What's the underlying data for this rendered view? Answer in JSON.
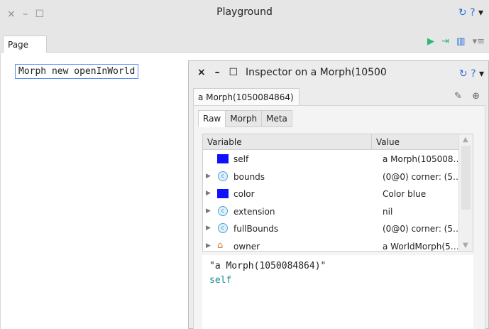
{
  "playground": {
    "title": "Playground",
    "window_controls": "× – ☐",
    "help": "?",
    "menu_arrow": "▾",
    "sync_icon": "↻",
    "tab": "Page",
    "code": "Morph new openInWorld"
  },
  "inspector": {
    "title": "Inspector on a Morph(10500",
    "window_controls": "× – ☐",
    "help": "?",
    "menu_arrow": "▾",
    "sync_icon": "↻",
    "object_tab": "a Morph(1050084864)",
    "subtabs": [
      "Raw",
      "Morph",
      "Meta"
    ],
    "columns": {
      "variable": "Variable",
      "value": "Value"
    },
    "rows": [
      {
        "name": "self",
        "value": "a Morph(105008…",
        "icon": "blue-square-icon"
      },
      {
        "name": "bounds",
        "value": "(0@0) corner: (5…",
        "icon": "class-circle-icon"
      },
      {
        "name": "color",
        "value": "Color blue",
        "icon": "blue-square-icon"
      },
      {
        "name": "extension",
        "value": "nil",
        "icon": "class-circle-icon"
      },
      {
        "name": "fullBounds",
        "value": "(0@0) corner: (5…",
        "icon": "class-circle-icon"
      },
      {
        "name": "owner",
        "value": "a WorldMorph(5…",
        "icon": "house-icon"
      }
    ],
    "eval_result": "\"a Morph(1050084864)\"",
    "eval_code": "self"
  },
  "colors": {
    "accent": "#2a6fdc",
    "play": "#2bb673",
    "morph_blue": "#1010ff"
  }
}
